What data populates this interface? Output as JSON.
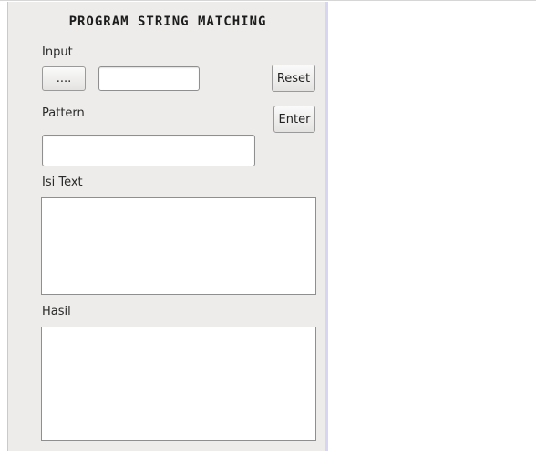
{
  "title": "PROGRAM STRING MATCHING",
  "input": {
    "label": "Input",
    "browse_label": "....",
    "value": "",
    "placeholder": ""
  },
  "pattern": {
    "label": "Pattern",
    "value": "",
    "placeholder": ""
  },
  "buttons": {
    "reset_label": "Reset",
    "enter_label": "Enter"
  },
  "isi_text": {
    "label": "Isi Text",
    "value": ""
  },
  "hasil": {
    "label": "Hasil",
    "value": ""
  }
}
